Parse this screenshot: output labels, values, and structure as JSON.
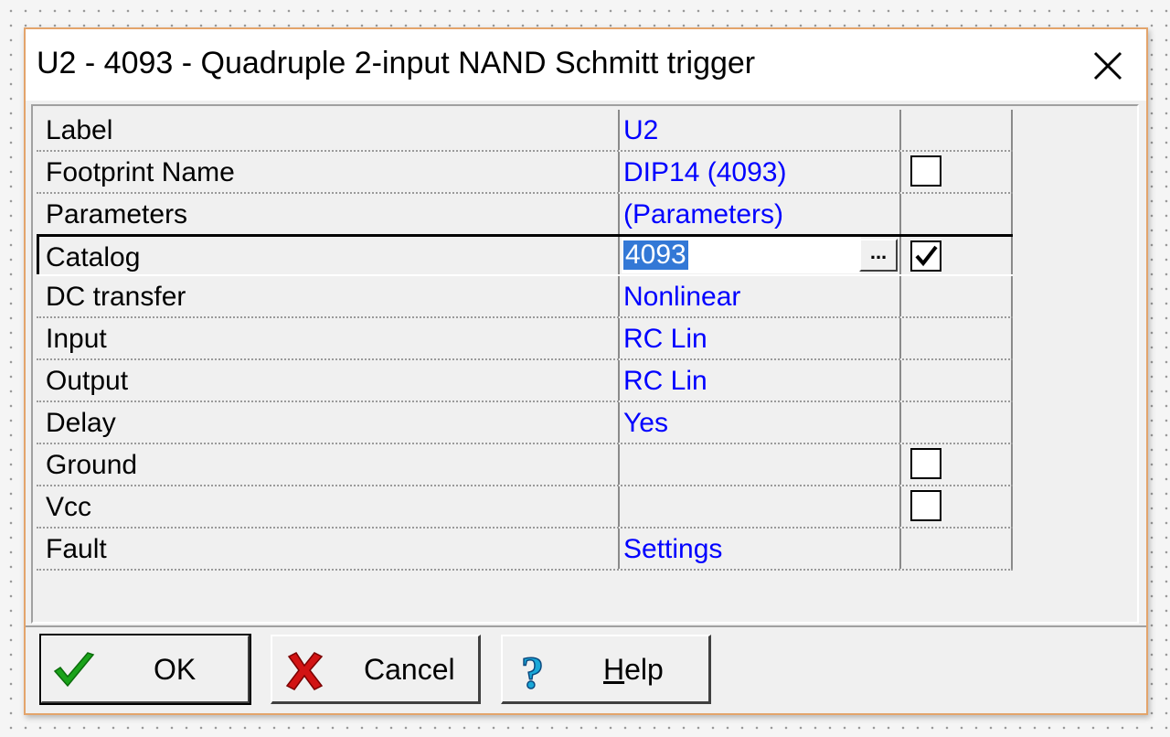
{
  "window": {
    "title": "U2 - 4093 - Quadruple 2-input NAND Schmitt trigger"
  },
  "properties": [
    {
      "label": "Label",
      "value": "U2",
      "checkbox": null
    },
    {
      "label": "Footprint Name",
      "value": "DIP14 (4093)",
      "checkbox": false
    },
    {
      "label": "Parameters",
      "value": "(Parameters)",
      "checkbox": null
    },
    {
      "label": "Catalog",
      "value": "4093",
      "checkbox": true,
      "editing": true
    },
    {
      "label": "DC transfer",
      "value": "Nonlinear",
      "checkbox": null
    },
    {
      "label": "Input",
      "value": "RC Lin",
      "checkbox": null
    },
    {
      "label": "Output",
      "value": "RC Lin",
      "checkbox": null
    },
    {
      "label": "Delay",
      "value": "Yes",
      "checkbox": null
    },
    {
      "label": "Ground",
      "value": "",
      "checkbox": false
    },
    {
      "label": "Vcc",
      "value": "",
      "checkbox": false
    },
    {
      "label": "Fault",
      "value": "Settings",
      "checkbox": null
    }
  ],
  "edit_button_label": "...",
  "buttons": {
    "ok": "OK",
    "cancel": "Cancel",
    "help_underlined": "H",
    "help_rest": "elp"
  },
  "colors": {
    "value_text": "#0000ff",
    "selection": "#3378d6",
    "dialog_border": "#e3a46b"
  },
  "icons": {
    "close": "close-icon",
    "ok": "checkmark-icon",
    "cancel": "red-x-icon",
    "help": "question-mark-icon"
  }
}
